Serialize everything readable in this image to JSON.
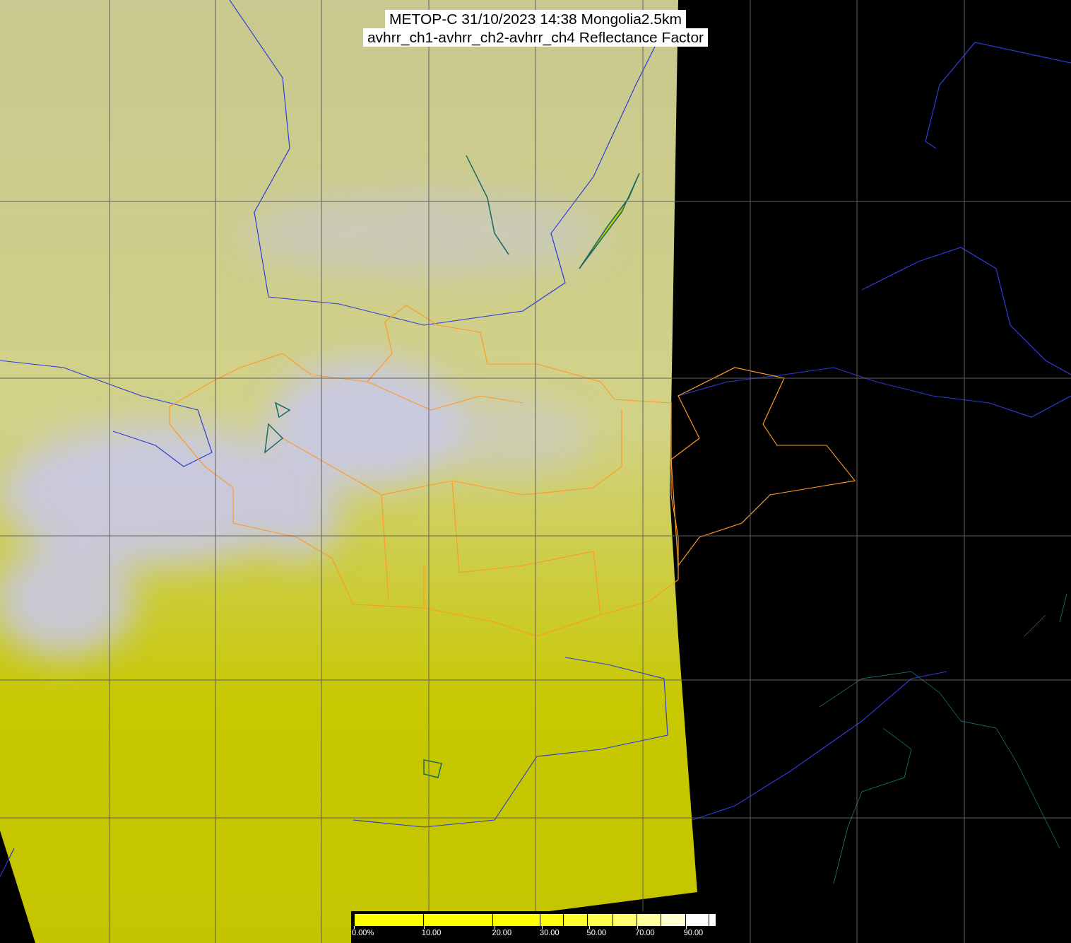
{
  "title": {
    "lines": [
      "METOP-C 31/10/2023 14:38 Mongolia2.5km",
      "avhrr_ch1-avhrr_ch2-avhrr_ch4 Reflectance Factor"
    ]
  },
  "colorbar": {
    "segments": [
      {
        "color": "#ffff00",
        "label": "0.00%"
      },
      {
        "color": "#ffff00",
        "label": "10.00"
      },
      {
        "color": "#ffff00",
        "label": "20.00"
      },
      {
        "color": "#ffff10",
        "label": "30.00"
      },
      {
        "color": "#ffff30"
      },
      {
        "color": "#ffff50",
        "label": "50.00"
      },
      {
        "color": "#ffff70"
      },
      {
        "color": "#ffffa0",
        "label": "70.00"
      },
      {
        "color": "#ffffd0"
      },
      {
        "color": "#ffffff",
        "label": "90.00"
      },
      {
        "color": "#ffffff"
      }
    ]
  }
}
